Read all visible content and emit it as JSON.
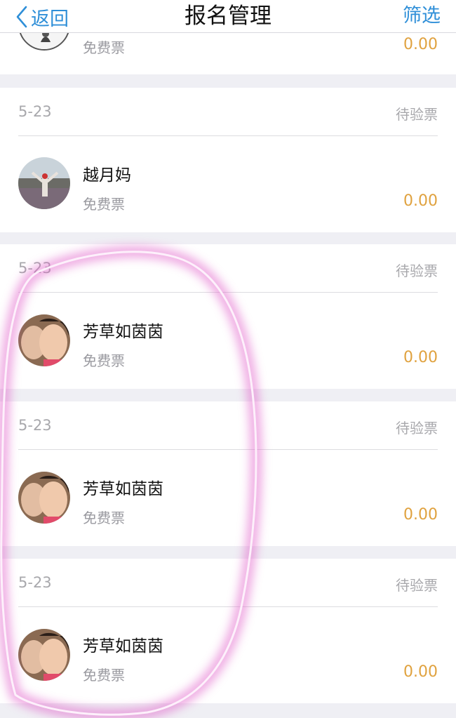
{
  "nav": {
    "back_label": "返回",
    "title": "报名管理",
    "filter_label": "筛选"
  },
  "colors": {
    "accent": "#2f8fd8",
    "price": "#e0a23f",
    "highlight": "#e05cc8"
  },
  "partial_top": {
    "ticket": "免费票",
    "price": "0.00"
  },
  "entries": [
    {
      "date": "5-23",
      "status": "待验票",
      "name": "越月妈",
      "ticket": "免费票",
      "price": "0.00"
    },
    {
      "date": "5-23",
      "status": "待验票",
      "name": "芳草如茵茵",
      "ticket": "免费票",
      "price": "0.00"
    },
    {
      "date": "5-23",
      "status": "待验票",
      "name": "芳草如茵茵",
      "ticket": "免费票",
      "price": "0.00"
    },
    {
      "date": "5-23",
      "status": "待验票",
      "name": "芳草如茵茵",
      "ticket": "免费票",
      "price": "0.00"
    }
  ]
}
